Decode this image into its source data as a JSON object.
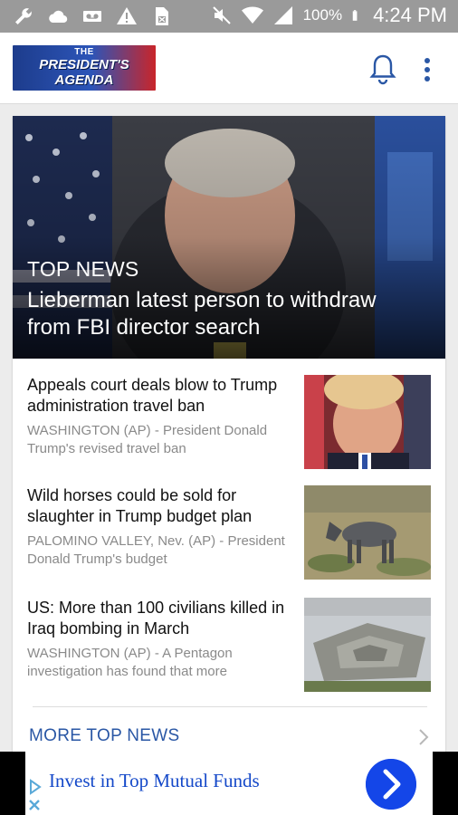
{
  "status_bar": {
    "battery": "100%",
    "time": "4:24 PM",
    "icons": [
      "wrench-icon",
      "cloud-icon",
      "voicemail-icon",
      "alert-icon",
      "sim-icon",
      "mute-icon",
      "wifi-icon",
      "signal-icon",
      "battery-icon"
    ]
  },
  "app_bar": {
    "logo_line1": "THE",
    "logo_line2": "PRESIDENT'S",
    "logo_line3": "AGENDA",
    "icons": [
      "bell-icon",
      "more-vert-icon"
    ]
  },
  "hero": {
    "label": "TOP NEWS",
    "title": "Lieberman latest person to withdraw from FBI director search"
  },
  "stories": [
    {
      "title": "Appeals court deals blow to Trump administration travel ban",
      "snippet": "WASHINGTON (AP) - President Donald Trump's revised travel ban"
    },
    {
      "title": "Wild horses could be sold for slaughter in Trump budget plan",
      "snippet": "PALOMINO VALLEY, Nev. (AP) - President Donald Trump's budget"
    },
    {
      "title": "US: More than 100 civilians killed in Iraq bombing in March",
      "snippet": "WASHINGTON (AP) - A Pentagon investigation has found that more"
    }
  ],
  "more_link": "MORE TOP NEWS",
  "ad": {
    "text": "Invest in Top Mutual Funds"
  },
  "colors": {
    "status_bar": "#9a9a9a",
    "accent_link": "#2a57a5",
    "ad_button": "#1446e8"
  }
}
